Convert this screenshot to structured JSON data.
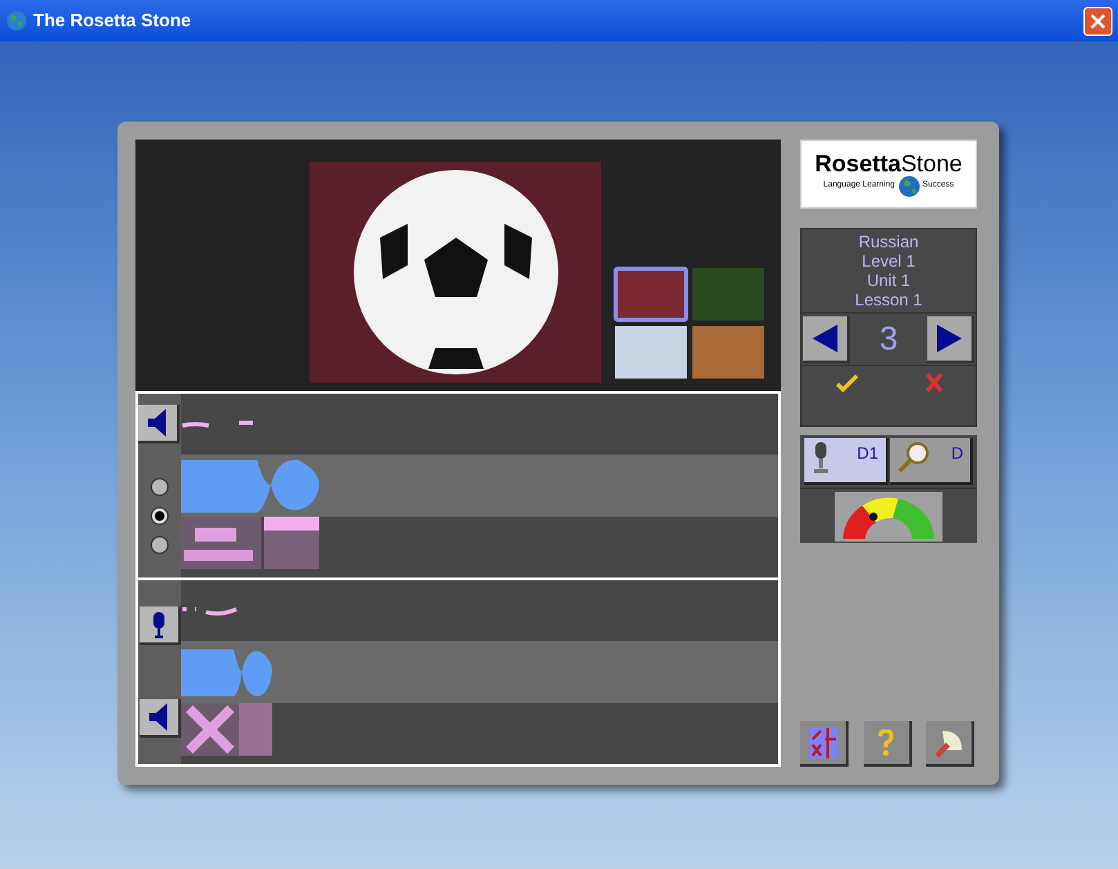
{
  "window": {
    "title": "The Rosetta Stone"
  },
  "logo": {
    "name_bold": "Rosetta",
    "name_light": "Stone",
    "tagline_left": "Language Learning",
    "tagline_right": "Success"
  },
  "course": {
    "lines": [
      "Russian",
      "Level 1",
      "Unit 1",
      "Lesson 1"
    ],
    "screen_number": "3"
  },
  "thumbnails": [
    {
      "kind": "ball",
      "selected": true
    },
    {
      "kind": "horse",
      "selected": false
    },
    {
      "kind": "snow",
      "selected": false
    },
    {
      "kind": "elephant",
      "selected": false
    }
  ],
  "choices": [
    {
      "selected": false
    },
    {
      "selected": true
    },
    {
      "selected": false
    }
  ],
  "modes": [
    {
      "label": "D1",
      "kind": "mic",
      "selected": true
    },
    {
      "label": "D",
      "kind": "magnifier",
      "selected": false
    }
  ]
}
